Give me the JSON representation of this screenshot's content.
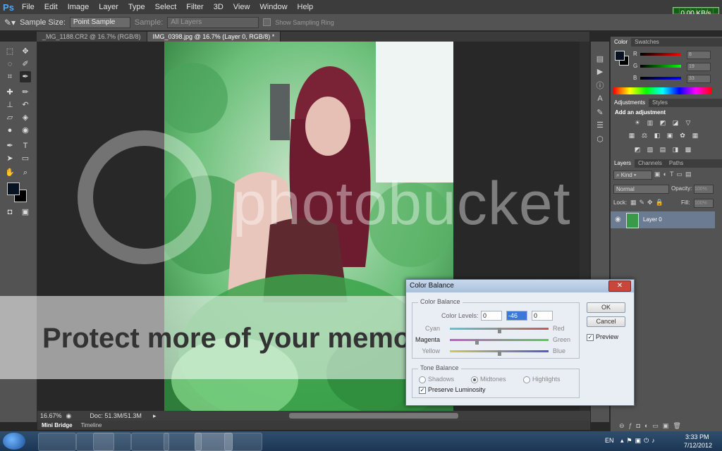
{
  "app": {
    "logo": "Ps",
    "menu": [
      "File",
      "Edit",
      "Image",
      "Layer",
      "Type",
      "Select",
      "Filter",
      "3D",
      "View",
      "Window",
      "Help"
    ]
  },
  "net_widget": {
    "value": "0.00 KB/s"
  },
  "options_bar": {
    "sample_size_label": "Sample Size:",
    "sample_size_value": "Point Sample",
    "sample_label": "Sample:",
    "sample_value": "All Layers",
    "ring_label": "Show Sampling Ring"
  },
  "doc_tabs": [
    {
      "label": "_MG_1188.CR2 @ 16.7% (RGB/8)"
    },
    {
      "label": "IMG_0398.jpg @ 16.7% (Layer 0, RGB/8) *"
    }
  ],
  "status": {
    "zoom": "16.67%",
    "doc": "Doc: 51.3M/51.3M"
  },
  "mini_bridge": {
    "tab1": "Mini Bridge",
    "tab2": "Timeline"
  },
  "color_panel": {
    "tab_color": "Color",
    "tab_swatches": "Swatches",
    "r_label": "R",
    "r_value": "8",
    "g_label": "G",
    "g_value": "19",
    "b_label": "B",
    "b_value": "33",
    "fg_color": "#081321",
    "bg_color": "#000000"
  },
  "adjustments_panel": {
    "tab_adjustments": "Adjustments",
    "tab_styles": "Styles",
    "heading": "Add an adjustment"
  },
  "layers_panel": {
    "tab_layers": "Layers",
    "tab_channels": "Channels",
    "tab_paths": "Paths",
    "kind_label": "Kind",
    "blend_mode": "Normal",
    "opacity_label": "Opacity:",
    "opacity_value": "100%",
    "lock_label": "Lock:",
    "fill_label": "Fill:",
    "fill_value": "100%",
    "layer_name": "Layer 0"
  },
  "color_balance": {
    "title": "Color Balance",
    "group1": "Color Balance",
    "levels_label": "Color Levels:",
    "levels": [
      "0",
      "-46",
      "0"
    ],
    "sliders": [
      {
        "left": "Cyan",
        "right": "Red",
        "value": 0
      },
      {
        "left": "Magenta",
        "right": "Green",
        "value": -46
      },
      {
        "left": "Yellow",
        "right": "Blue",
        "value": 0
      }
    ],
    "group2": "Tone Balance",
    "shadows": "Shadows",
    "midtones": "Midtones",
    "highlights": "Highlights",
    "preserve": "Preserve Luminosity",
    "ok": "OK",
    "cancel": "Cancel",
    "preview": "Preview"
  },
  "watermark": {
    "brand": "photobucket",
    "protect": "Protect more of your memories"
  },
  "taskbar": {
    "lang": "EN",
    "time": "3:33 PM",
    "date": "7/12/2012"
  }
}
